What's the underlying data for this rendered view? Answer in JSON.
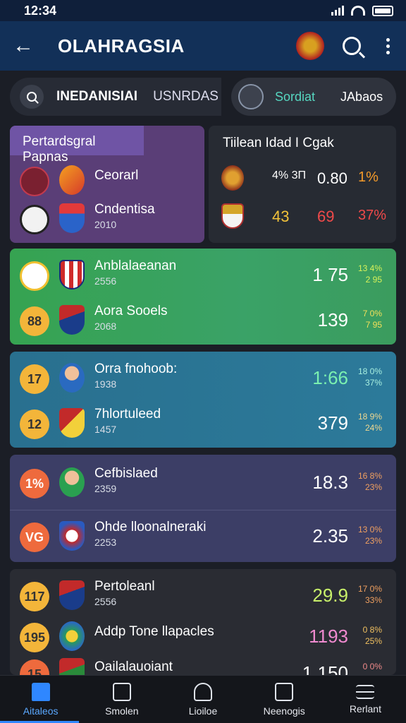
{
  "status_bar": {
    "time": "12:34"
  },
  "app_bar": {
    "title": "OLAHRAGSIA"
  },
  "filters": {
    "tab_1": "INEDANISIAI",
    "tab_2": "USNRDAS",
    "segment_1": "Sordiat",
    "segment_2": "JAbaos"
  },
  "featured": {
    "heading": "Pertardsgral Papnas",
    "rows": [
      {
        "name": "Ceorarl",
        "sub": ""
      },
      {
        "name": "Cndentisa",
        "sub": "2010"
      }
    ]
  },
  "stats_panel": {
    "title": "Tiilean Idad I Cgak",
    "rows": [
      {
        "v1": "4%\n3Π",
        "v2": "0.80",
        "v3": "1%"
      },
      {
        "v1": "43",
        "v2": "69",
        "v3": "37%"
      }
    ]
  },
  "groups": [
    {
      "rows": [
        {
          "badge": "",
          "name": "Anblalaeanan",
          "sub": "2556",
          "value": "1 75",
          "pct_1": "13 4%",
          "pct_2": "2 95"
        },
        {
          "badge": "88",
          "name": "Aora Sooels",
          "sub": "2068",
          "value": "139",
          "pct_1": "7 0%",
          "pct_2": "7 95"
        }
      ]
    },
    {
      "rows": [
        {
          "badge": "17",
          "name": "Orra fnohoob:",
          "sub": "1938",
          "value": "1:66",
          "pct_1": "18 0%",
          "pct_2": "37%"
        },
        {
          "badge": "12",
          "name": "7hlortuleed",
          "sub": "1457",
          "value": "379",
          "pct_1": "18 9%",
          "pct_2": "24%"
        }
      ]
    },
    {
      "rows": [
        {
          "badge": "1%",
          "name": "Cefbislaed",
          "sub": "2359",
          "value": "18.3",
          "pct_1": "16 8%",
          "pct_2": "23%"
        },
        {
          "badge": "VG",
          "name": "Ohde lloonalneraki",
          "sub": "2253",
          "value": "2.35",
          "pct_1": "13 0%",
          "pct_2": "23%"
        }
      ]
    },
    {
      "rows": [
        {
          "badge": "117",
          "name": "Pertoleanl",
          "sub": "2556",
          "value": "29.9",
          "pct_1": "17 0%",
          "pct_2": "33%"
        },
        {
          "badge": "195",
          "name": "Addp Tone llapacles",
          "sub": "",
          "value": "1193",
          "pct_1": "0 8%",
          "pct_2": "25%"
        },
        {
          "badge": "15",
          "name": "Oailalauoiant",
          "sub": "",
          "value": "1.150",
          "pct_1": "0 0%",
          "pct_2": ""
        }
      ]
    }
  ],
  "bottom_nav": [
    {
      "label": "Aitaleos",
      "icon": "home-icon",
      "active": true
    },
    {
      "label": "Smolen",
      "icon": "schedule-icon",
      "active": false
    },
    {
      "label": "Lioiloe",
      "icon": "teams-icon",
      "active": false
    },
    {
      "label": "Neenogis",
      "icon": "news-icon",
      "active": false
    },
    {
      "label": "Rerlant",
      "icon": "menu-icon",
      "active": false
    }
  ],
  "colors": {
    "app_bar": "#123058",
    "green_card": "#36a351",
    "teal_card": "#29708f",
    "violet_card": "#3c3e66",
    "accent": "#2f87ff",
    "badge_yellow": "#f3b53a",
    "badge_orange": "#ee6a3d"
  }
}
